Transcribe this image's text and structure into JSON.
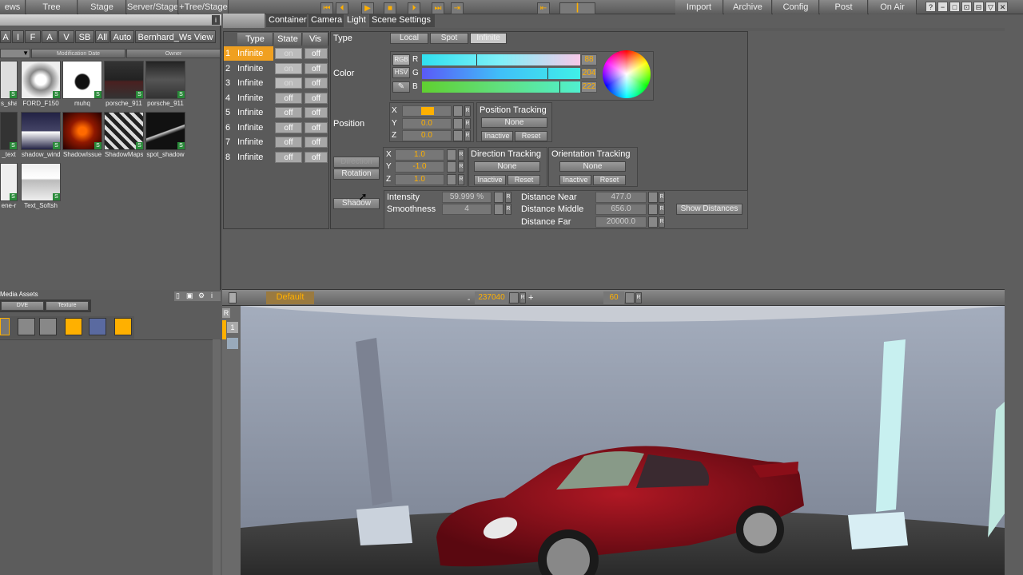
{
  "topbar": {
    "left_tabs": [
      "ews",
      "Tree",
      "Stage",
      "Server/Stage",
      "+Tree/Stage"
    ],
    "right_tabs": [
      "Import",
      "Archive",
      "Config",
      "Post",
      "On Air"
    ],
    "window_buttons": [
      "?",
      "−",
      "□",
      "⊡",
      "⊟",
      "▽",
      "✕"
    ]
  },
  "left": {
    "filters": [
      "A",
      "I",
      "F",
      "A",
      "V",
      "SB",
      "All",
      "Auto"
    ],
    "view_label": "Bernhard_Ws View",
    "sort_cols": [
      "Modification Date",
      "Owner"
    ],
    "info": "i",
    "thumbs": [
      {
        "label": "s_sha"
      },
      {
        "label": "FORD_F150"
      },
      {
        "label": "muhq"
      },
      {
        "label": "porsche_911"
      },
      {
        "label": "porsche_911"
      },
      {
        "label": "_text"
      },
      {
        "label": "shadow_wind"
      },
      {
        "label": "ShadowIssue"
      },
      {
        "label": "ShadowMaps"
      },
      {
        "label": "spot_shadow"
      },
      {
        "label": "ene-r"
      },
      {
        "label": "Text_Softsh"
      }
    ],
    "badge": "S"
  },
  "media": {
    "title": "Media Assets",
    "tabs": [
      "DVE",
      "Texture"
    ]
  },
  "tabs": [
    "Container",
    "Camera",
    "Light",
    "Scene Settings"
  ],
  "lightlist": {
    "headers": [
      "Type",
      "State",
      "Vis"
    ],
    "rows": [
      {
        "n": "1",
        "type": "Infinite",
        "state": "on",
        "vis": "off"
      },
      {
        "n": "2",
        "type": "Infinite",
        "state": "on",
        "vis": "off"
      },
      {
        "n": "3",
        "type": "Infinite",
        "state": "on",
        "vis": "off"
      },
      {
        "n": "4",
        "type": "Infinite",
        "state": "off",
        "vis": "off"
      },
      {
        "n": "5",
        "type": "Infinite",
        "state": "off",
        "vis": "off"
      },
      {
        "n": "6",
        "type": "Infinite",
        "state": "off",
        "vis": "off"
      },
      {
        "n": "7",
        "type": "Infinite",
        "state": "off",
        "vis": "off"
      },
      {
        "n": "8",
        "type": "Infinite",
        "state": "off",
        "vis": "off"
      }
    ]
  },
  "editor": {
    "type_label": "Type",
    "types": [
      "Local",
      "Spot",
      "Infinite"
    ],
    "color_label": "Color",
    "color_modes": [
      "RGB",
      "HSV"
    ],
    "rgb": {
      "r_label": "R",
      "g_label": "G",
      "b_label": "B",
      "r": "88",
      "g": "204",
      "b": "222"
    },
    "position_label": "Position",
    "pos": {
      "x": "",
      "y": "0.0",
      "z": "0.0"
    },
    "pos_tracking": {
      "title": "Position Tracking",
      "none": "None",
      "inactive": "Inactive",
      "reset": "Reset"
    },
    "dir_rot": [
      "Direction",
      "Rotation"
    ],
    "dir": {
      "x": "1.0",
      "y": "-1.0",
      "z": "1.0"
    },
    "dir_tracking": {
      "title": "Direction Tracking",
      "none": "None",
      "inactive": "Inactive",
      "reset": "Reset"
    },
    "ori_tracking": {
      "title": "Orientation Tracking",
      "none": "None",
      "inactive": "Inactive",
      "reset": "Reset"
    },
    "shadow": "Shadow",
    "intensity_label": "Intensity",
    "intensity": "59.999 %",
    "smooth_label": "Smoothness",
    "smooth": "4",
    "near_label": "Distance Near",
    "near": "477.0",
    "mid_label": "Distance Middle",
    "mid": "656.0",
    "far_label": "Distance Far",
    "far": "20000.0",
    "show_dist": "Show Distances"
  },
  "playbar": {
    "default": "Default",
    "frame": "237040",
    "fps": "60",
    "r": "R",
    "plus": "+"
  },
  "vtool": {
    "page": "1"
  },
  "colors": {
    "accent": "#ffb000",
    "selected_row": "#f0a020"
  }
}
